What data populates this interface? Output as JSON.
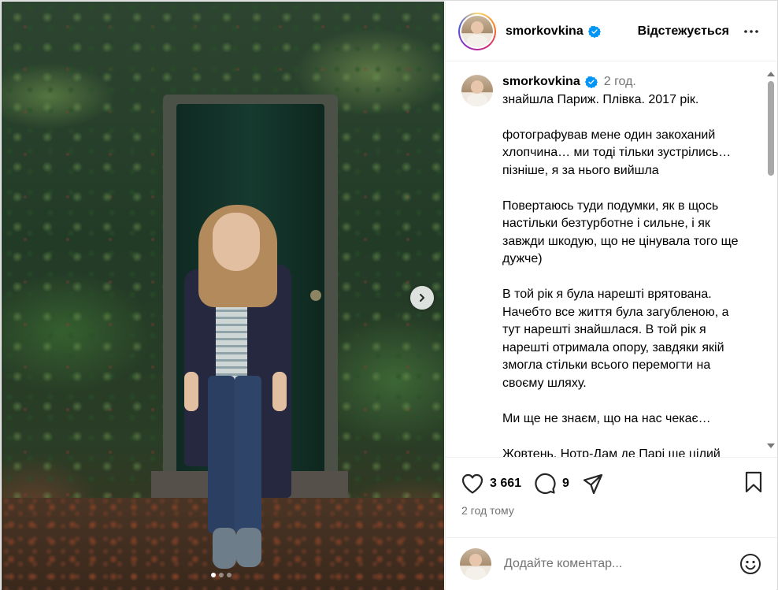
{
  "post": {
    "username": "smorkovkina",
    "follow_label": "Відстежується",
    "more_icon": "more-horizontal-icon",
    "verified_icon": "verified-badge-icon"
  },
  "caption": {
    "username": "smorkovkina",
    "time": "2 год.",
    "text": "знайшла Париж. Плівка. 2017 рік.\n\nфотографував мене один закоханий хлопчина… ми тоді тільки зустрілись… пізніше, я за нього вийшла\n\nПовертаюсь туди подумки, як в щось настільки безтурботне і сильне, і як завжди шкодую, що не цінувала того ще дужче)\n\nВ той рік я була нарешті врятована. Начебто все життя була загубленою, а тут нарешті знайшлася. В той рік я нарешті отримала опору, завдяки якій змогла стільки всього перемогти на своєму шляху.\n\nМи ще не знаєм, що на нас чекає…\n\nЖовтень. Нотр-Дам де Парі ще цілий"
  },
  "actions": {
    "likes": "3 661",
    "comments": "9",
    "posted": "2 год тому"
  },
  "comment": {
    "placeholder": "Додайте коментар..."
  },
  "carousel": {
    "slide_count": 3,
    "active_index": 0
  },
  "colors": {
    "verified": "#0095f6",
    "secondary_text": "#737373"
  }
}
